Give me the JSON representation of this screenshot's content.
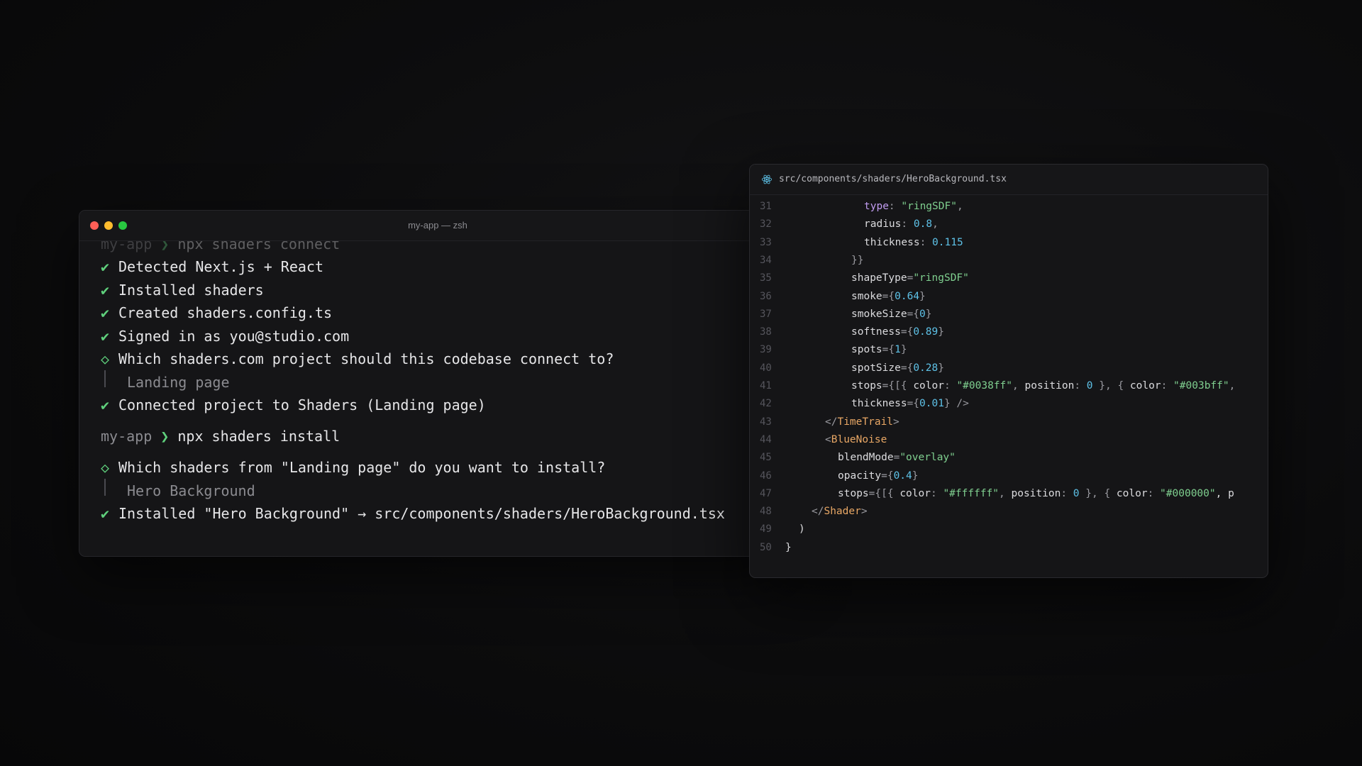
{
  "terminal": {
    "title": "my-app — zsh",
    "lines": {
      "prev_dir": "my-app",
      "prev_arrow": "❯",
      "prev_cmd": "npx shaders connect",
      "check_mark": "✔",
      "diamond_mark": "◇",
      "l1": "Detected Next.js + React",
      "l2": "Installed shaders",
      "l3": "Created shaders.config.ts",
      "l4": "Signed in as you@studio.com",
      "q1": "Which shaders.com project should this codebase connect to?",
      "a1": "Landing page",
      "l5": "Connected project to Shaders (Landing page)",
      "prompt_dir": "my-app",
      "prompt_arrow": "❯",
      "cmd2": "npx shaders install",
      "q2": "Which shaders from \"Landing page\" do you want to install?",
      "a2": "Hero Background",
      "l6": "Installed \"Hero Background\" → src/components/shaders/HeroBackground.tsx"
    }
  },
  "editor": {
    "file_icon": "react-icon",
    "file_path": "src/components/shaders/HeroBackground.tsx",
    "lines": [
      {
        "n": "31",
        "t": [
          "type",
          ": ",
          "\"ringSDF\"",
          ","
        ]
      },
      {
        "n": "32",
        "t": [
          "radius",
          ": ",
          "0.8",
          ","
        ]
      },
      {
        "n": "33",
        "t": [
          "thickness",
          ": ",
          "0.115"
        ]
      },
      {
        "n": "34",
        "t": [
          "}}"
        ]
      },
      {
        "n": "35",
        "t": [
          "shapeType",
          "=",
          "\"ringSDF\""
        ]
      },
      {
        "n": "36",
        "t": [
          "smoke",
          "={",
          "0.64",
          "}"
        ]
      },
      {
        "n": "37",
        "t": [
          "smokeSize",
          "={",
          "0",
          "}"
        ]
      },
      {
        "n": "38",
        "t": [
          "softness",
          "={",
          "0.89",
          "}"
        ]
      },
      {
        "n": "39",
        "t": [
          "spots",
          "={",
          "1",
          "}"
        ]
      },
      {
        "n": "40",
        "t": [
          "spotSize",
          "={",
          "0.28",
          "}"
        ]
      },
      {
        "n": "41",
        "t": [
          "stops",
          "={[{ ",
          "color",
          ": ",
          "\"#0038ff\"",
          ", ",
          "position",
          ": ",
          "0",
          " }, { ",
          "color",
          ": ",
          "\"#003bff\"",
          ","
        ]
      },
      {
        "n": "42",
        "t": [
          "thickness",
          "={",
          "0.01",
          "} />"
        ]
      },
      {
        "n": "43",
        "t": [
          "</",
          "TimeTrail",
          ">"
        ]
      },
      {
        "n": "44",
        "t": [
          "<",
          "BlueNoise"
        ]
      },
      {
        "n": "45",
        "t": [
          "blendMode",
          "=",
          "\"overlay\""
        ]
      },
      {
        "n": "46",
        "t": [
          "opacity",
          "={",
          "0.4",
          "}"
        ]
      },
      {
        "n": "47",
        "t": [
          "stops",
          "={[{ ",
          "color",
          ": ",
          "\"#ffffff\"",
          ", ",
          "position",
          ": ",
          "0",
          " }, { ",
          "color",
          ": ",
          "\"#000000\"",
          ", p"
        ]
      },
      {
        "n": "48",
        "t": [
          "</",
          "Shader",
          ">"
        ]
      },
      {
        "n": "49",
        "t": [
          ")"
        ]
      },
      {
        "n": "50",
        "t": [
          "}"
        ]
      }
    ]
  }
}
